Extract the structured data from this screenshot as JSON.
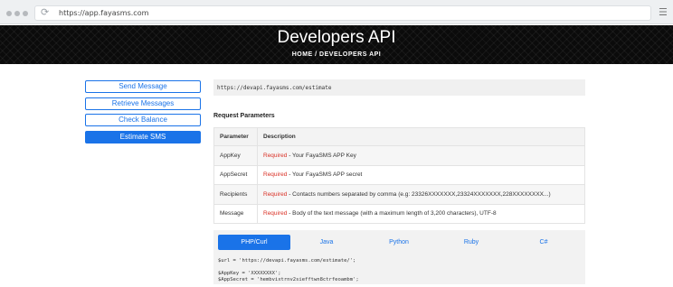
{
  "browser": {
    "url": "https://app.fayasms.com"
  },
  "hero": {
    "title": "Developers API",
    "breadcrumb": "HOME / DEVELOPERS API"
  },
  "sidebar": {
    "items": [
      {
        "label": "Send Message",
        "active": false
      },
      {
        "label": "Retrieve Messages",
        "active": false
      },
      {
        "label": "Check Balance",
        "active": false
      },
      {
        "label": "Estimate SMS",
        "active": true
      }
    ]
  },
  "main": {
    "endpoint": "https://devapi.fayasms.com/estimate",
    "section_title": "Request Parameters",
    "table": {
      "headers": [
        "Parameter",
        "Description"
      ],
      "rows": [
        {
          "param": "AppKey",
          "required": "Required",
          "desc": " - Your FayaSMS APP Key"
        },
        {
          "param": "AppSecret",
          "required": "Required",
          "desc": " - Your FayaSMS APP secret"
        },
        {
          "param": "Recipients",
          "required": "Required",
          "desc": " - Contacts numbers separated by comma (e.g: 23326XXXXXXX,23324XXXXXXX,228XXXXXXXX...)"
        },
        {
          "param": "Message",
          "required": "Required",
          "desc": " - Body of the text message (with a maximum length of 3,200 characters), UTF-8"
        }
      ]
    },
    "code_tabs": [
      "PHP/Curl",
      "Java",
      "Python",
      "Ruby",
      "C#"
    ],
    "active_tab": "PHP/Curl",
    "code_lines": [
      "$url = 'https://devapi.fayasms.com/estimate/';",
      "",
      "$AppKey = 'XXXXXXXX';",
      "$AppSecret = 'hembvixtrnv2siefftwn8ctrfeoambm';"
    ]
  },
  "colors": {
    "accent": "#1a73e8",
    "required": "#d93025",
    "hero_bg": "#0b0b0b"
  }
}
